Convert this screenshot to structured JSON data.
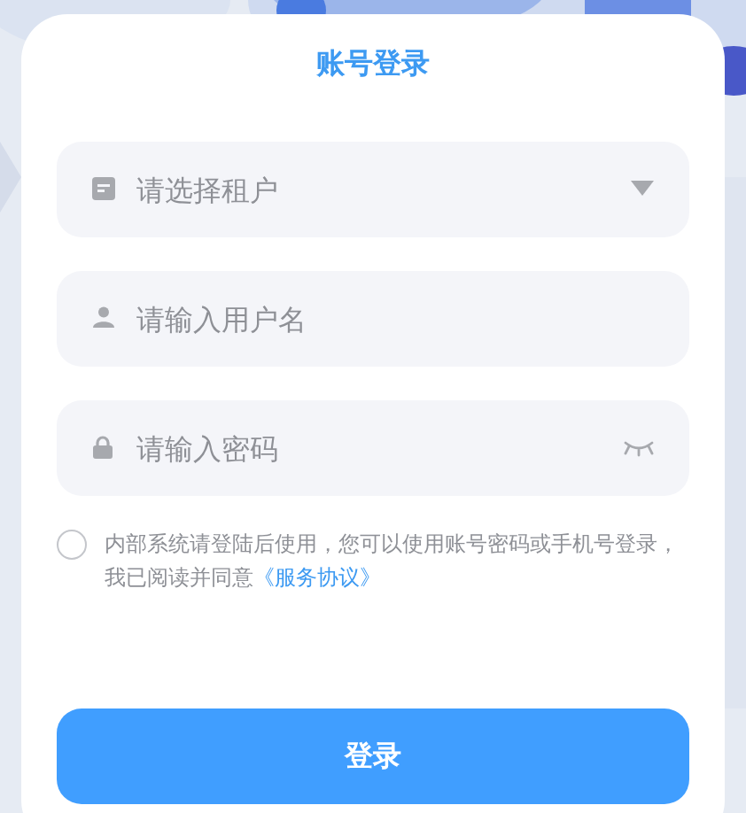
{
  "title": "账号登录",
  "fields": [
    {
      "kind": "select",
      "placeholder": "请选择租户"
    },
    {
      "kind": "text",
      "placeholder": "请输入用户名"
    },
    {
      "kind": "password",
      "placeholder": "请输入密码"
    }
  ],
  "agreement": {
    "checked": false,
    "text": "内部系统请登陆后使用，您可以使用账号密码或手机号登录，我已阅读并同意",
    "link": "《服务协议》"
  },
  "submit": "登录"
}
